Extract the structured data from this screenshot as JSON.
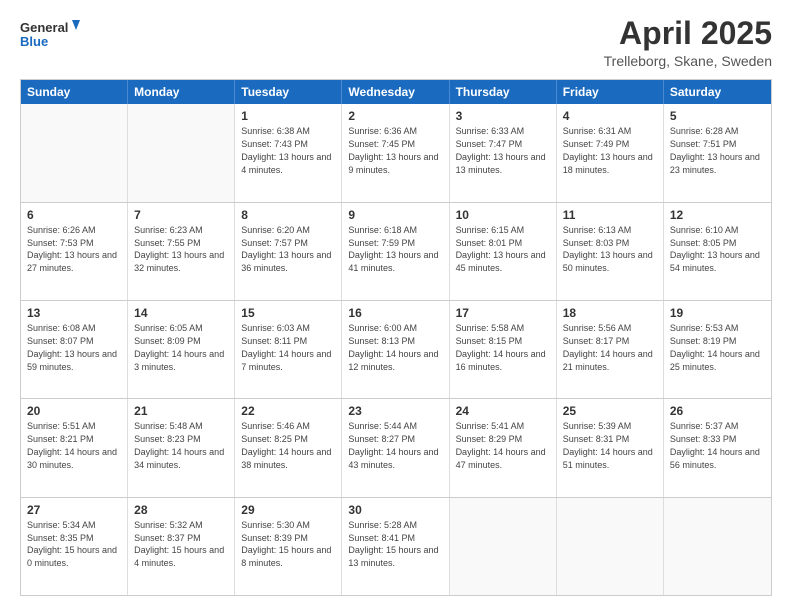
{
  "logo": {
    "line1": "General",
    "line2": "Blue"
  },
  "header": {
    "month_year": "April 2025",
    "location": "Trelleborg, Skane, Sweden"
  },
  "days_of_week": [
    "Sunday",
    "Monday",
    "Tuesday",
    "Wednesday",
    "Thursday",
    "Friday",
    "Saturday"
  ],
  "weeks": [
    [
      {
        "day": "",
        "text": ""
      },
      {
        "day": "",
        "text": ""
      },
      {
        "day": "1",
        "text": "Sunrise: 6:38 AM\nSunset: 7:43 PM\nDaylight: 13 hours and 4 minutes."
      },
      {
        "day": "2",
        "text": "Sunrise: 6:36 AM\nSunset: 7:45 PM\nDaylight: 13 hours and 9 minutes."
      },
      {
        "day": "3",
        "text": "Sunrise: 6:33 AM\nSunset: 7:47 PM\nDaylight: 13 hours and 13 minutes."
      },
      {
        "day": "4",
        "text": "Sunrise: 6:31 AM\nSunset: 7:49 PM\nDaylight: 13 hours and 18 minutes."
      },
      {
        "day": "5",
        "text": "Sunrise: 6:28 AM\nSunset: 7:51 PM\nDaylight: 13 hours and 23 minutes."
      }
    ],
    [
      {
        "day": "6",
        "text": "Sunrise: 6:26 AM\nSunset: 7:53 PM\nDaylight: 13 hours and 27 minutes."
      },
      {
        "day": "7",
        "text": "Sunrise: 6:23 AM\nSunset: 7:55 PM\nDaylight: 13 hours and 32 minutes."
      },
      {
        "day": "8",
        "text": "Sunrise: 6:20 AM\nSunset: 7:57 PM\nDaylight: 13 hours and 36 minutes."
      },
      {
        "day": "9",
        "text": "Sunrise: 6:18 AM\nSunset: 7:59 PM\nDaylight: 13 hours and 41 minutes."
      },
      {
        "day": "10",
        "text": "Sunrise: 6:15 AM\nSunset: 8:01 PM\nDaylight: 13 hours and 45 minutes."
      },
      {
        "day": "11",
        "text": "Sunrise: 6:13 AM\nSunset: 8:03 PM\nDaylight: 13 hours and 50 minutes."
      },
      {
        "day": "12",
        "text": "Sunrise: 6:10 AM\nSunset: 8:05 PM\nDaylight: 13 hours and 54 minutes."
      }
    ],
    [
      {
        "day": "13",
        "text": "Sunrise: 6:08 AM\nSunset: 8:07 PM\nDaylight: 13 hours and 59 minutes."
      },
      {
        "day": "14",
        "text": "Sunrise: 6:05 AM\nSunset: 8:09 PM\nDaylight: 14 hours and 3 minutes."
      },
      {
        "day": "15",
        "text": "Sunrise: 6:03 AM\nSunset: 8:11 PM\nDaylight: 14 hours and 7 minutes."
      },
      {
        "day": "16",
        "text": "Sunrise: 6:00 AM\nSunset: 8:13 PM\nDaylight: 14 hours and 12 minutes."
      },
      {
        "day": "17",
        "text": "Sunrise: 5:58 AM\nSunset: 8:15 PM\nDaylight: 14 hours and 16 minutes."
      },
      {
        "day": "18",
        "text": "Sunrise: 5:56 AM\nSunset: 8:17 PM\nDaylight: 14 hours and 21 minutes."
      },
      {
        "day": "19",
        "text": "Sunrise: 5:53 AM\nSunset: 8:19 PM\nDaylight: 14 hours and 25 minutes."
      }
    ],
    [
      {
        "day": "20",
        "text": "Sunrise: 5:51 AM\nSunset: 8:21 PM\nDaylight: 14 hours and 30 minutes."
      },
      {
        "day": "21",
        "text": "Sunrise: 5:48 AM\nSunset: 8:23 PM\nDaylight: 14 hours and 34 minutes."
      },
      {
        "day": "22",
        "text": "Sunrise: 5:46 AM\nSunset: 8:25 PM\nDaylight: 14 hours and 38 minutes."
      },
      {
        "day": "23",
        "text": "Sunrise: 5:44 AM\nSunset: 8:27 PM\nDaylight: 14 hours and 43 minutes."
      },
      {
        "day": "24",
        "text": "Sunrise: 5:41 AM\nSunset: 8:29 PM\nDaylight: 14 hours and 47 minutes."
      },
      {
        "day": "25",
        "text": "Sunrise: 5:39 AM\nSunset: 8:31 PM\nDaylight: 14 hours and 51 minutes."
      },
      {
        "day": "26",
        "text": "Sunrise: 5:37 AM\nSunset: 8:33 PM\nDaylight: 14 hours and 56 minutes."
      }
    ],
    [
      {
        "day": "27",
        "text": "Sunrise: 5:34 AM\nSunset: 8:35 PM\nDaylight: 15 hours and 0 minutes."
      },
      {
        "day": "28",
        "text": "Sunrise: 5:32 AM\nSunset: 8:37 PM\nDaylight: 15 hours and 4 minutes."
      },
      {
        "day": "29",
        "text": "Sunrise: 5:30 AM\nSunset: 8:39 PM\nDaylight: 15 hours and 8 minutes."
      },
      {
        "day": "30",
        "text": "Sunrise: 5:28 AM\nSunset: 8:41 PM\nDaylight: 15 hours and 13 minutes."
      },
      {
        "day": "",
        "text": ""
      },
      {
        "day": "",
        "text": ""
      },
      {
        "day": "",
        "text": ""
      }
    ]
  ]
}
